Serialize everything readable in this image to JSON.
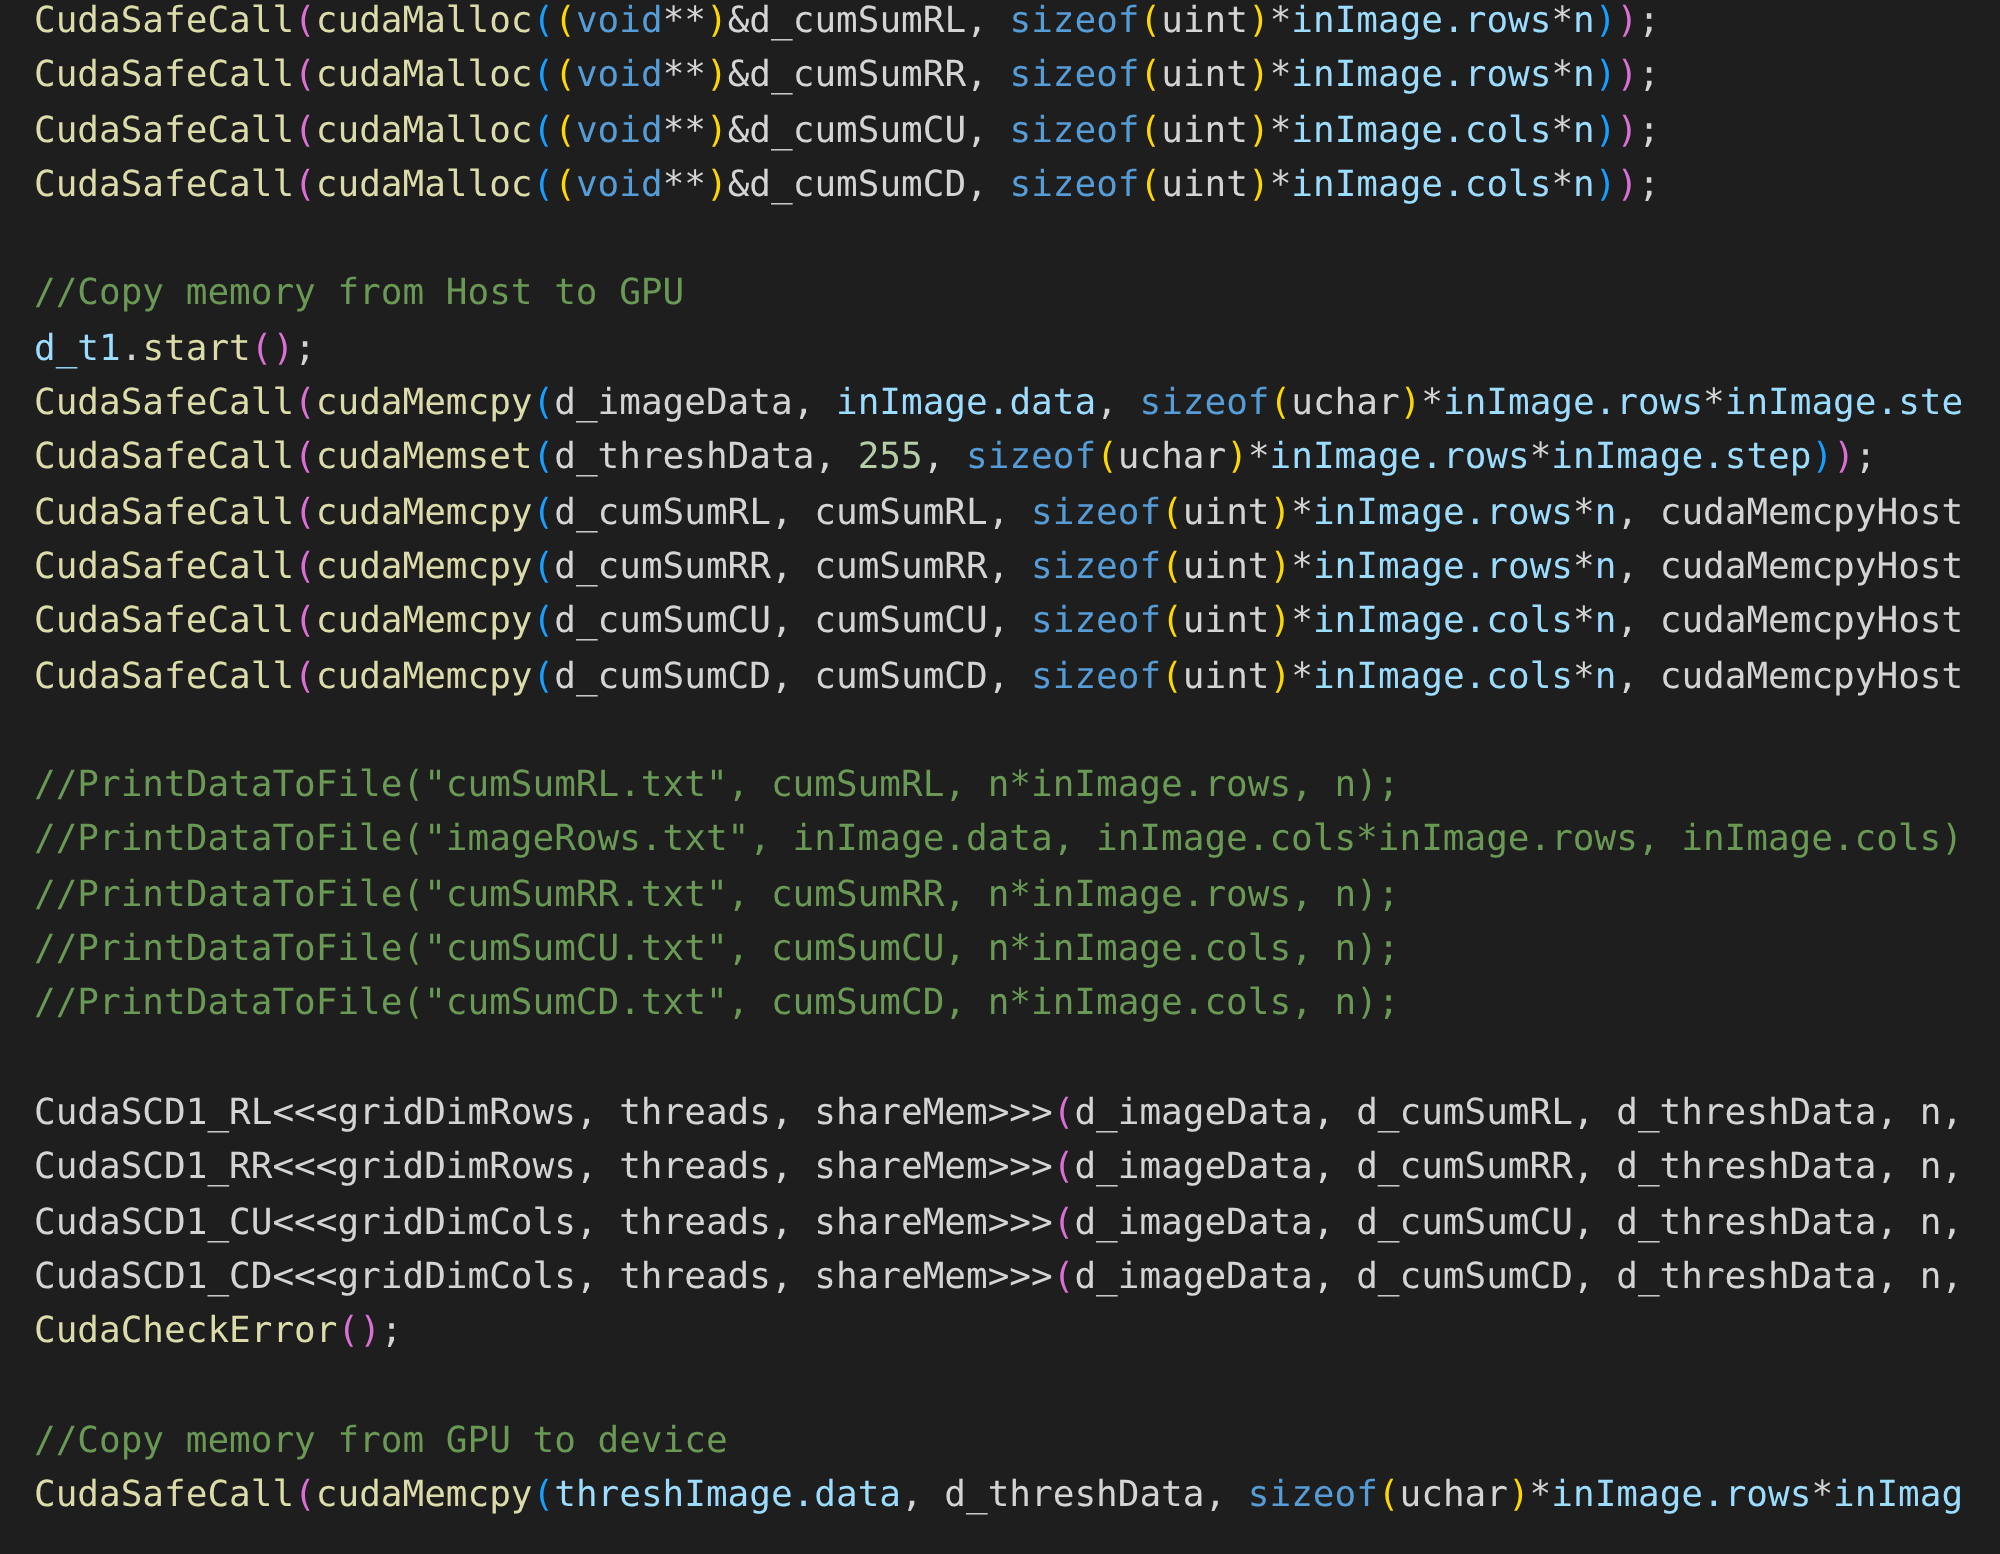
{
  "code_blocks": [
    {
      "lines": [
        {
          "tokens": [
            {
              "text": "CudaSafeCall",
              "kind": "fn"
            },
            {
              "text": "(",
              "kind": "b1"
            },
            {
              "text": "cudaMalloc",
              "kind": "fn"
            },
            {
              "text": "(",
              "kind": "b2"
            },
            {
              "text": "(",
              "kind": "b3"
            },
            {
              "text": "void",
              "kind": "kw"
            },
            {
              "text": "**",
              "kind": "plain"
            },
            {
              "text": ")",
              "kind": "b3"
            },
            {
              "text": "&d_cumSumRL, ",
              "kind": "plain"
            },
            {
              "text": "sizeof",
              "kind": "kw"
            },
            {
              "text": "(",
              "kind": "b3"
            },
            {
              "text": "uint",
              "kind": "plain"
            },
            {
              "text": ")",
              "kind": "b3"
            },
            {
              "text": "*",
              "kind": "plain"
            },
            {
              "text": "inImage.rows",
              "kind": "var"
            },
            {
              "text": "*",
              "kind": "plain"
            },
            {
              "text": "n",
              "kind": "var"
            },
            {
              "text": ")",
              "kind": "b2"
            },
            {
              "text": ")",
              "kind": "b1"
            },
            {
              "text": ";",
              "kind": "plain"
            }
          ]
        },
        {
          "tokens": [
            {
              "text": "CudaSafeCall",
              "kind": "fn"
            },
            {
              "text": "(",
              "kind": "b1"
            },
            {
              "text": "cudaMalloc",
              "kind": "fn"
            },
            {
              "text": "(",
              "kind": "b2"
            },
            {
              "text": "(",
              "kind": "b3"
            },
            {
              "text": "void",
              "kind": "kw"
            },
            {
              "text": "**",
              "kind": "plain"
            },
            {
              "text": ")",
              "kind": "b3"
            },
            {
              "text": "&d_cumSumRR, ",
              "kind": "plain"
            },
            {
              "text": "sizeof",
              "kind": "kw"
            },
            {
              "text": "(",
              "kind": "b3"
            },
            {
              "text": "uint",
              "kind": "plain"
            },
            {
              "text": ")",
              "kind": "b3"
            },
            {
              "text": "*",
              "kind": "plain"
            },
            {
              "text": "inImage.rows",
              "kind": "var"
            },
            {
              "text": "*",
              "kind": "plain"
            },
            {
              "text": "n",
              "kind": "var"
            },
            {
              "text": ")",
              "kind": "b2"
            },
            {
              "text": ")",
              "kind": "b1"
            },
            {
              "text": ";",
              "kind": "plain"
            }
          ]
        },
        {
          "tokens": [
            {
              "text": "CudaSafeCall",
              "kind": "fn"
            },
            {
              "text": "(",
              "kind": "b1"
            },
            {
              "text": "cudaMalloc",
              "kind": "fn"
            },
            {
              "text": "(",
              "kind": "b2"
            },
            {
              "text": "(",
              "kind": "b3"
            },
            {
              "text": "void",
              "kind": "kw"
            },
            {
              "text": "**",
              "kind": "plain"
            },
            {
              "text": ")",
              "kind": "b3"
            },
            {
              "text": "&d_cumSumCU, ",
              "kind": "plain"
            },
            {
              "text": "sizeof",
              "kind": "kw"
            },
            {
              "text": "(",
              "kind": "b3"
            },
            {
              "text": "uint",
              "kind": "plain"
            },
            {
              "text": ")",
              "kind": "b3"
            },
            {
              "text": "*",
              "kind": "plain"
            },
            {
              "text": "inImage.cols",
              "kind": "var"
            },
            {
              "text": "*",
              "kind": "plain"
            },
            {
              "text": "n",
              "kind": "var"
            },
            {
              "text": ")",
              "kind": "b2"
            },
            {
              "text": ")",
              "kind": "b1"
            },
            {
              "text": ";",
              "kind": "plain"
            }
          ]
        },
        {
          "tokens": [
            {
              "text": "CudaSafeCall",
              "kind": "fn"
            },
            {
              "text": "(",
              "kind": "b1"
            },
            {
              "text": "cudaMalloc",
              "kind": "fn"
            },
            {
              "text": "(",
              "kind": "b2"
            },
            {
              "text": "(",
              "kind": "b3"
            },
            {
              "text": "void",
              "kind": "kw"
            },
            {
              "text": "**",
              "kind": "plain"
            },
            {
              "text": ")",
              "kind": "b3"
            },
            {
              "text": "&d_cumSumCD, ",
              "kind": "plain"
            },
            {
              "text": "sizeof",
              "kind": "kw"
            },
            {
              "text": "(",
              "kind": "b3"
            },
            {
              "text": "uint",
              "kind": "plain"
            },
            {
              "text": ")",
              "kind": "b3"
            },
            {
              "text": "*",
              "kind": "plain"
            },
            {
              "text": "inImage.cols",
              "kind": "var"
            },
            {
              "text": "*",
              "kind": "plain"
            },
            {
              "text": "n",
              "kind": "var"
            },
            {
              "text": ")",
              "kind": "b2"
            },
            {
              "text": ")",
              "kind": "b1"
            },
            {
              "text": ";",
              "kind": "plain"
            }
          ]
        }
      ]
    },
    {
      "lines": [
        {
          "tokens": [
            {
              "text": "//Copy memory from Host to GPU",
              "kind": "comment"
            }
          ]
        },
        {
          "tokens": [
            {
              "text": "d_t1",
              "kind": "var"
            },
            {
              "text": ".",
              "kind": "plain"
            },
            {
              "text": "start",
              "kind": "fn"
            },
            {
              "text": "(",
              "kind": "b1"
            },
            {
              "text": ")",
              "kind": "b1"
            },
            {
              "text": ";",
              "kind": "plain"
            }
          ]
        },
        {
          "tokens": [
            {
              "text": "CudaSafeCall",
              "kind": "fn"
            },
            {
              "text": "(",
              "kind": "b1"
            },
            {
              "text": "cudaMemcpy",
              "kind": "fn"
            },
            {
              "text": "(",
              "kind": "b2"
            },
            {
              "text": "d_imageData, ",
              "kind": "plain"
            },
            {
              "text": "inImage.data",
              "kind": "var"
            },
            {
              "text": ", ",
              "kind": "plain"
            },
            {
              "text": "sizeof",
              "kind": "kw"
            },
            {
              "text": "(",
              "kind": "b3"
            },
            {
              "text": "uchar",
              "kind": "plain"
            },
            {
              "text": ")",
              "kind": "b3"
            },
            {
              "text": "*",
              "kind": "plain"
            },
            {
              "text": "inImage.rows",
              "kind": "var"
            },
            {
              "text": "*",
              "kind": "plain"
            },
            {
              "text": "inImage.ste",
              "kind": "var"
            }
          ]
        },
        {
          "tokens": [
            {
              "text": "CudaSafeCall",
              "kind": "fn"
            },
            {
              "text": "(",
              "kind": "b1"
            },
            {
              "text": "cudaMemset",
              "kind": "fn"
            },
            {
              "text": "(",
              "kind": "b2"
            },
            {
              "text": "d_threshData, ",
              "kind": "plain"
            },
            {
              "text": "255",
              "kind": "num"
            },
            {
              "text": ", ",
              "kind": "plain"
            },
            {
              "text": "sizeof",
              "kind": "kw"
            },
            {
              "text": "(",
              "kind": "b3"
            },
            {
              "text": "uchar",
              "kind": "plain"
            },
            {
              "text": ")",
              "kind": "b3"
            },
            {
              "text": "*",
              "kind": "plain"
            },
            {
              "text": "inImage.rows",
              "kind": "var"
            },
            {
              "text": "*",
              "kind": "plain"
            },
            {
              "text": "inImage.step",
              "kind": "var"
            },
            {
              "text": ")",
              "kind": "b2"
            },
            {
              "text": ")",
              "kind": "b1"
            },
            {
              "text": ";",
              "kind": "plain"
            }
          ]
        },
        {
          "tokens": [
            {
              "text": "CudaSafeCall",
              "kind": "fn"
            },
            {
              "text": "(",
              "kind": "b1"
            },
            {
              "text": "cudaMemcpy",
              "kind": "fn"
            },
            {
              "text": "(",
              "kind": "b2"
            },
            {
              "text": "d_cumSumRL, cumSumRL, ",
              "kind": "plain"
            },
            {
              "text": "sizeof",
              "kind": "kw"
            },
            {
              "text": "(",
              "kind": "b3"
            },
            {
              "text": "uint",
              "kind": "plain"
            },
            {
              "text": ")",
              "kind": "b3"
            },
            {
              "text": "*",
              "kind": "plain"
            },
            {
              "text": "inImage.rows",
              "kind": "var"
            },
            {
              "text": "*",
              "kind": "plain"
            },
            {
              "text": "n",
              "kind": "var"
            },
            {
              "text": ", cudaMemcpyHost",
              "kind": "plain"
            }
          ]
        },
        {
          "tokens": [
            {
              "text": "CudaSafeCall",
              "kind": "fn"
            },
            {
              "text": "(",
              "kind": "b1"
            },
            {
              "text": "cudaMemcpy",
              "kind": "fn"
            },
            {
              "text": "(",
              "kind": "b2"
            },
            {
              "text": "d_cumSumRR, cumSumRR, ",
              "kind": "plain"
            },
            {
              "text": "sizeof",
              "kind": "kw"
            },
            {
              "text": "(",
              "kind": "b3"
            },
            {
              "text": "uint",
              "kind": "plain"
            },
            {
              "text": ")",
              "kind": "b3"
            },
            {
              "text": "*",
              "kind": "plain"
            },
            {
              "text": "inImage.rows",
              "kind": "var"
            },
            {
              "text": "*",
              "kind": "plain"
            },
            {
              "text": "n",
              "kind": "var"
            },
            {
              "text": ", cudaMemcpyHost",
              "kind": "plain"
            }
          ]
        },
        {
          "tokens": [
            {
              "text": "CudaSafeCall",
              "kind": "fn"
            },
            {
              "text": "(",
              "kind": "b1"
            },
            {
              "text": "cudaMemcpy",
              "kind": "fn"
            },
            {
              "text": "(",
              "kind": "b2"
            },
            {
              "text": "d_cumSumCU, cumSumCU, ",
              "kind": "plain"
            },
            {
              "text": "sizeof",
              "kind": "kw"
            },
            {
              "text": "(",
              "kind": "b3"
            },
            {
              "text": "uint",
              "kind": "plain"
            },
            {
              "text": ")",
              "kind": "b3"
            },
            {
              "text": "*",
              "kind": "plain"
            },
            {
              "text": "inImage.cols",
              "kind": "var"
            },
            {
              "text": "*",
              "kind": "plain"
            },
            {
              "text": "n",
              "kind": "var"
            },
            {
              "text": ", cudaMemcpyHost",
              "kind": "plain"
            }
          ]
        },
        {
          "tokens": [
            {
              "text": "CudaSafeCall",
              "kind": "fn"
            },
            {
              "text": "(",
              "kind": "b1"
            },
            {
              "text": "cudaMemcpy",
              "kind": "fn"
            },
            {
              "text": "(",
              "kind": "b2"
            },
            {
              "text": "d_cumSumCD, cumSumCD, ",
              "kind": "plain"
            },
            {
              "text": "sizeof",
              "kind": "kw"
            },
            {
              "text": "(",
              "kind": "b3"
            },
            {
              "text": "uint",
              "kind": "plain"
            },
            {
              "text": ")",
              "kind": "b3"
            },
            {
              "text": "*",
              "kind": "plain"
            },
            {
              "text": "inImage.cols",
              "kind": "var"
            },
            {
              "text": "*",
              "kind": "plain"
            },
            {
              "text": "n",
              "kind": "var"
            },
            {
              "text": ", cudaMemcpyHost",
              "kind": "plain"
            }
          ]
        }
      ]
    },
    {
      "lines": [
        {
          "tokens": [
            {
              "text": "//PrintDataToFile(\"cumSumRL.txt\", cumSumRL, n*inImage.rows, n);",
              "kind": "comment"
            }
          ]
        },
        {
          "tokens": [
            {
              "text": "//PrintDataToFile(\"imageRows.txt\", inImage.data, inImage.cols*inImage.rows, inImage.cols)",
              "kind": "comment"
            }
          ]
        },
        {
          "tokens": [
            {
              "text": "//PrintDataToFile(\"cumSumRR.txt\", cumSumRR, n*inImage.rows, n);",
              "kind": "comment"
            }
          ]
        },
        {
          "tokens": [
            {
              "text": "//PrintDataToFile(\"cumSumCU.txt\", cumSumCU, n*inImage.cols, n);",
              "kind": "comment"
            }
          ]
        },
        {
          "tokens": [
            {
              "text": "//PrintDataToFile(\"cumSumCD.txt\", cumSumCD, n*inImage.cols, n);",
              "kind": "comment"
            }
          ]
        }
      ]
    },
    {
      "lines": [
        {
          "tokens": [
            {
              "text": "CudaSCD1_RL<<<gridDimRows, threads, shareMem>>>",
              "kind": "plain"
            },
            {
              "text": "(",
              "kind": "b1"
            },
            {
              "text": "d_imageData, d_cumSumRL, d_threshData, n,",
              "kind": "plain"
            }
          ]
        },
        {
          "tokens": [
            {
              "text": "CudaSCD1_RR<<<gridDimRows, threads, shareMem>>>",
              "kind": "plain"
            },
            {
              "text": "(",
              "kind": "b1"
            },
            {
              "text": "d_imageData, d_cumSumRR, d_threshData, n,",
              "kind": "plain"
            }
          ]
        },
        {
          "tokens": [
            {
              "text": "CudaSCD1_CU<<<gridDimCols, threads, shareMem>>>",
              "kind": "plain"
            },
            {
              "text": "(",
              "kind": "b1"
            },
            {
              "text": "d_imageData, d_cumSumCU, d_threshData, n,",
              "kind": "plain"
            }
          ]
        },
        {
          "tokens": [
            {
              "text": "CudaSCD1_CD<<<gridDimCols, threads, shareMem>>>",
              "kind": "plain"
            },
            {
              "text": "(",
              "kind": "b1"
            },
            {
              "text": "d_imageData, d_cumSumCD, d_threshData, n,",
              "kind": "plain"
            }
          ]
        },
        {
          "tokens": [
            {
              "text": "CudaCheckError",
              "kind": "fn"
            },
            {
              "text": "(",
              "kind": "b1"
            },
            {
              "text": ")",
              "kind": "b1"
            },
            {
              "text": ";",
              "kind": "plain"
            }
          ]
        }
      ]
    },
    {
      "lines": [
        {
          "tokens": [
            {
              "text": "//Copy memory from GPU to device",
              "kind": "comment"
            }
          ]
        },
        {
          "tokens": [
            {
              "text": "CudaSafeCall",
              "kind": "fn"
            },
            {
              "text": "(",
              "kind": "b1"
            },
            {
              "text": "cudaMemcpy",
              "kind": "fn"
            },
            {
              "text": "(",
              "kind": "b2"
            },
            {
              "text": "threshImage.data",
              "kind": "var"
            },
            {
              "text": ", d_threshData, ",
              "kind": "plain"
            },
            {
              "text": "sizeof",
              "kind": "kw"
            },
            {
              "text": "(",
              "kind": "b3"
            },
            {
              "text": "uchar",
              "kind": "plain"
            },
            {
              "text": ")",
              "kind": "b3"
            },
            {
              "text": "*",
              "kind": "plain"
            },
            {
              "text": "inImage.rows",
              "kind": "var"
            },
            {
              "text": "*",
              "kind": "plain"
            },
            {
              "text": "inImag",
              "kind": "var"
            }
          ]
        }
      ]
    }
  ]
}
